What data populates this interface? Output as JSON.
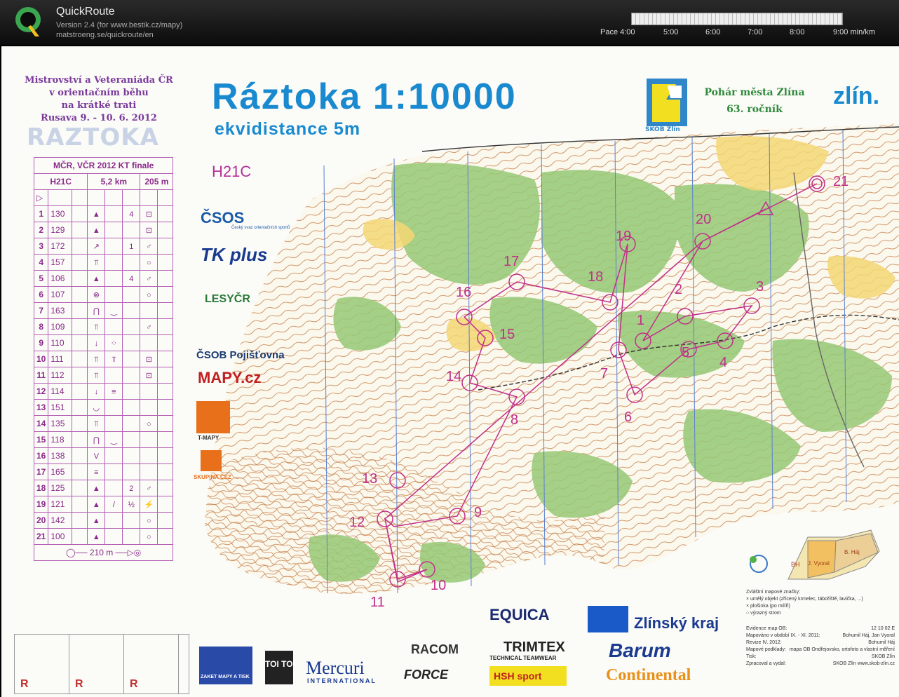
{
  "app": {
    "title": "QuickRoute",
    "version": "Version 2.4  (for www.bestik.cz/mapy)",
    "url": "matstroeng.se/quickroute/en"
  },
  "pace_scale": {
    "labels": [
      "Pace 4:00",
      "5:00",
      "6:00",
      "7:00",
      "8:00",
      "9:00  min/km"
    ]
  },
  "map": {
    "title": "Ráztoka 1:10000",
    "subtitle": "ekvidistance 5m",
    "course": "H21C",
    "event": [
      "Mistrovství a Veteraniáda ČR",
      "v orientačním běhu",
      "na krátké trati",
      "Rusava 9. - 10. 6. 2012"
    ],
    "watermark": "RAZTOKA",
    "club_name": "SKOB Zlín",
    "cup": [
      "Pohár města Zlína",
      "63. ročník"
    ],
    "city_logo": "zlín.",
    "area_labels": {
      "bh": "BH",
      "vyoral": "J. Vyoral",
      "haj": "B. Háj"
    }
  },
  "description_sheet": {
    "header": "MČR, VČR 2012 KT finale",
    "course": "H21C",
    "length": "5,2 km",
    "climb": "205 m",
    "controls": [
      {
        "n": "1",
        "code": "130"
      },
      {
        "n": "2",
        "code": "129"
      },
      {
        "n": "3",
        "code": "172"
      },
      {
        "n": "4",
        "code": "157"
      },
      {
        "n": "5",
        "code": "106"
      },
      {
        "n": "6",
        "code": "107"
      },
      {
        "n": "7",
        "code": "163"
      },
      {
        "n": "8",
        "code": "109"
      },
      {
        "n": "9",
        "code": "110"
      },
      {
        "n": "10",
        "code": "111"
      },
      {
        "n": "11",
        "code": "112"
      },
      {
        "n": "12",
        "code": "114"
      },
      {
        "n": "13",
        "code": "151"
      },
      {
        "n": "14",
        "code": "135"
      },
      {
        "n": "15",
        "code": "118"
      },
      {
        "n": "16",
        "code": "138"
      },
      {
        "n": "17",
        "code": "165"
      },
      {
        "n": "18",
        "code": "125"
      },
      {
        "n": "19",
        "code": "121"
      },
      {
        "n": "20",
        "code": "142"
      },
      {
        "n": "21",
        "code": "100"
      }
    ],
    "finish": "210 m",
    "r_labels": [
      "R",
      "R",
      "R"
    ]
  },
  "sponsors": {
    "csos": "ČSOS",
    "csos_sub": "Český svaz orientačních sportů",
    "tk": "TK plus",
    "lesy": "LESYČR",
    "csob": "ČSOB Pojišťovna",
    "mapy": "MAPY.cz",
    "tmapy": "T-MAPY",
    "cez": "SKUPINA ČEZ",
    "zaket": "ZAKET MAPY A TISK",
    "toitoi": "TOI TOI",
    "mercuri": "Mercuri",
    "mercuri_sub": "INTERNATIONAL",
    "racom": "RACOM",
    "force": "FORCE",
    "equica": "EQUICA",
    "trimtex": "TRIMTEX",
    "trimtex_sub": "TECHNICAL TEAMWEAR",
    "hsh": "HSH sport",
    "zlinsky": "Zlínský kraj",
    "barum": "Barum",
    "continental": "Continental"
  },
  "legend": {
    "title": "Zvláštní mapové značky:",
    "items": [
      "× umělý objekt (zřícený krmelec, tábořiště, lavička, ...)",
      "× plošinka (po milíři)",
      "○ výrazný strom"
    ]
  },
  "info": [
    {
      "k": "Evidence map OB:",
      "v": "12 10 02 E"
    },
    {
      "k": "Mapováno v období IX. - XI. 2011:",
      "v": "Bohumil Háj, Jan Vyoral"
    },
    {
      "k": "Revize IV. 2012:",
      "v": "Bohumil Háj"
    },
    {
      "k": "Mapové podklady:",
      "v": "mapa OB Ondřejovsko, ortofoto a vlastní měření"
    },
    {
      "k": "Tisk:",
      "v": "SKOB Zlín"
    },
    {
      "k": "Zpracoval a vydal:",
      "v": "SKOB Zlín  www.skob-zlin.cz"
    }
  ],
  "control_labels": [
    "1",
    "2",
    "3",
    "4",
    "5",
    "6",
    "7",
    "8",
    "9",
    "10",
    "11",
    "12",
    "13",
    "14",
    "15",
    "16",
    "17",
    "18",
    "19",
    "20",
    "21"
  ],
  "colors": {
    "course": "#c0308a",
    "green": "#8fc76a",
    "yellow": "#f2d060",
    "contour": "#c0713a",
    "north": "#5a7fd0"
  }
}
